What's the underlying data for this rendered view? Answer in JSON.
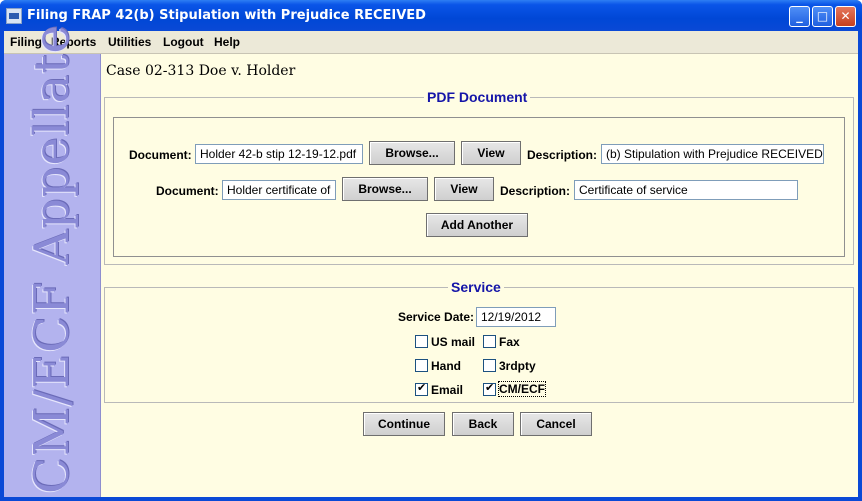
{
  "window": {
    "title": "Filing FRAP 42(b) Stipulation with Prejudice RECEIVED"
  },
  "title_buttons": {
    "minimize": "_",
    "maximize": "□",
    "close": "✕"
  },
  "menu": [
    "Filing",
    "Reports",
    "Utilities",
    "Logout",
    "Help"
  ],
  "sidebar": {
    "text": "CM/ECF Appellate"
  },
  "case": {
    "title": "Case 02-313 Doe v. Holder"
  },
  "pdf_section": {
    "legend": "PDF Document",
    "rows": [
      {
        "doc_label": "Document:",
        "doc_value": "Holder 42-b stip 12-19-12.pdf",
        "browse": "Browse...",
        "view": "View",
        "desc_label": "Description:",
        "desc_value": "(b) Stipulation with Prejudice RECEIVED"
      },
      {
        "doc_label": "Document:",
        "doc_value": "Holder certificate of",
        "browse": "Browse...",
        "view": "View",
        "desc_label": "Description:",
        "desc_value": "Certificate of service"
      }
    ],
    "add_another": "Add Another"
  },
  "service_section": {
    "legend": "Service",
    "date_label": "Service Date:",
    "date_value": "12/19/2012",
    "options": [
      {
        "label": "US mail",
        "checked": false
      },
      {
        "label": "Fax",
        "checked": false
      },
      {
        "label": "Hand",
        "checked": false
      },
      {
        "label": "3rdpty",
        "checked": false
      },
      {
        "label": "Email",
        "checked": true
      },
      {
        "label": "CM/ECF",
        "checked": true
      }
    ]
  },
  "actions": {
    "continue": "Continue",
    "back": "Back",
    "cancel": "Cancel"
  },
  "colors": {
    "titlebar": "#0a49d6",
    "client_bg": "#fffde3",
    "sidebar_bg": "#b3b3ee",
    "legend_text": "#1515a8"
  }
}
